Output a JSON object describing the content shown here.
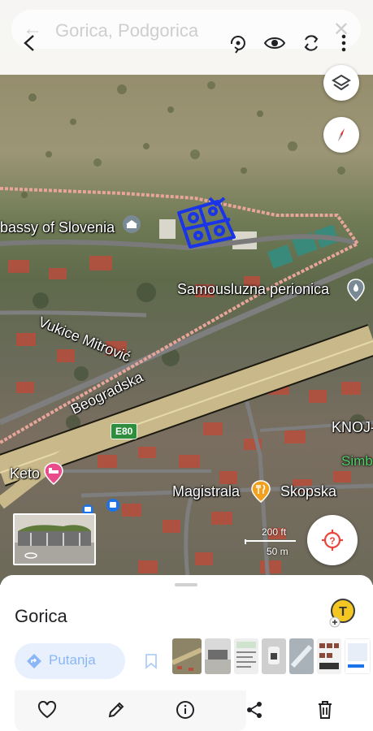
{
  "search": {
    "query": "Gorica, Podgorica"
  },
  "toolbar": {
    "back_icon": "chevron-left-icon",
    "actions": [
      "rotate-360-icon",
      "eye-icon",
      "sync-icon",
      "more-vert-icon"
    ]
  },
  "map": {
    "labels": {
      "embassy": "bassy of Slovenia",
      "carwash": "Samousluzna perionica",
      "street1": "Vukice Mitrović",
      "street2": "Beogradska",
      "highway": "E80",
      "knoj": "KNOJ-",
      "simb": "Simb",
      "keto": "Keto",
      "magistrala": "Magistrala",
      "skopska": "Skopska"
    },
    "scale": {
      "feet": "200 ft",
      "meters": "50 m"
    },
    "controls": [
      "layers-icon",
      "compass-icon",
      "help-location-icon"
    ],
    "colors": {
      "boundary": "#e8a59a",
      "annotation": "#1a35e8",
      "pin": "#7a8a94",
      "food": "#f2a11f",
      "hotel": "#e94c8a"
    }
  },
  "sheet": {
    "title": "Gorica",
    "route_label": "Putanja",
    "badge_icon": "avatar-badge-icon",
    "photos": 7
  },
  "actions": {
    "items": [
      "heart-icon",
      "edit-icon",
      "info-icon",
      "share-icon",
      "delete-icon"
    ]
  }
}
